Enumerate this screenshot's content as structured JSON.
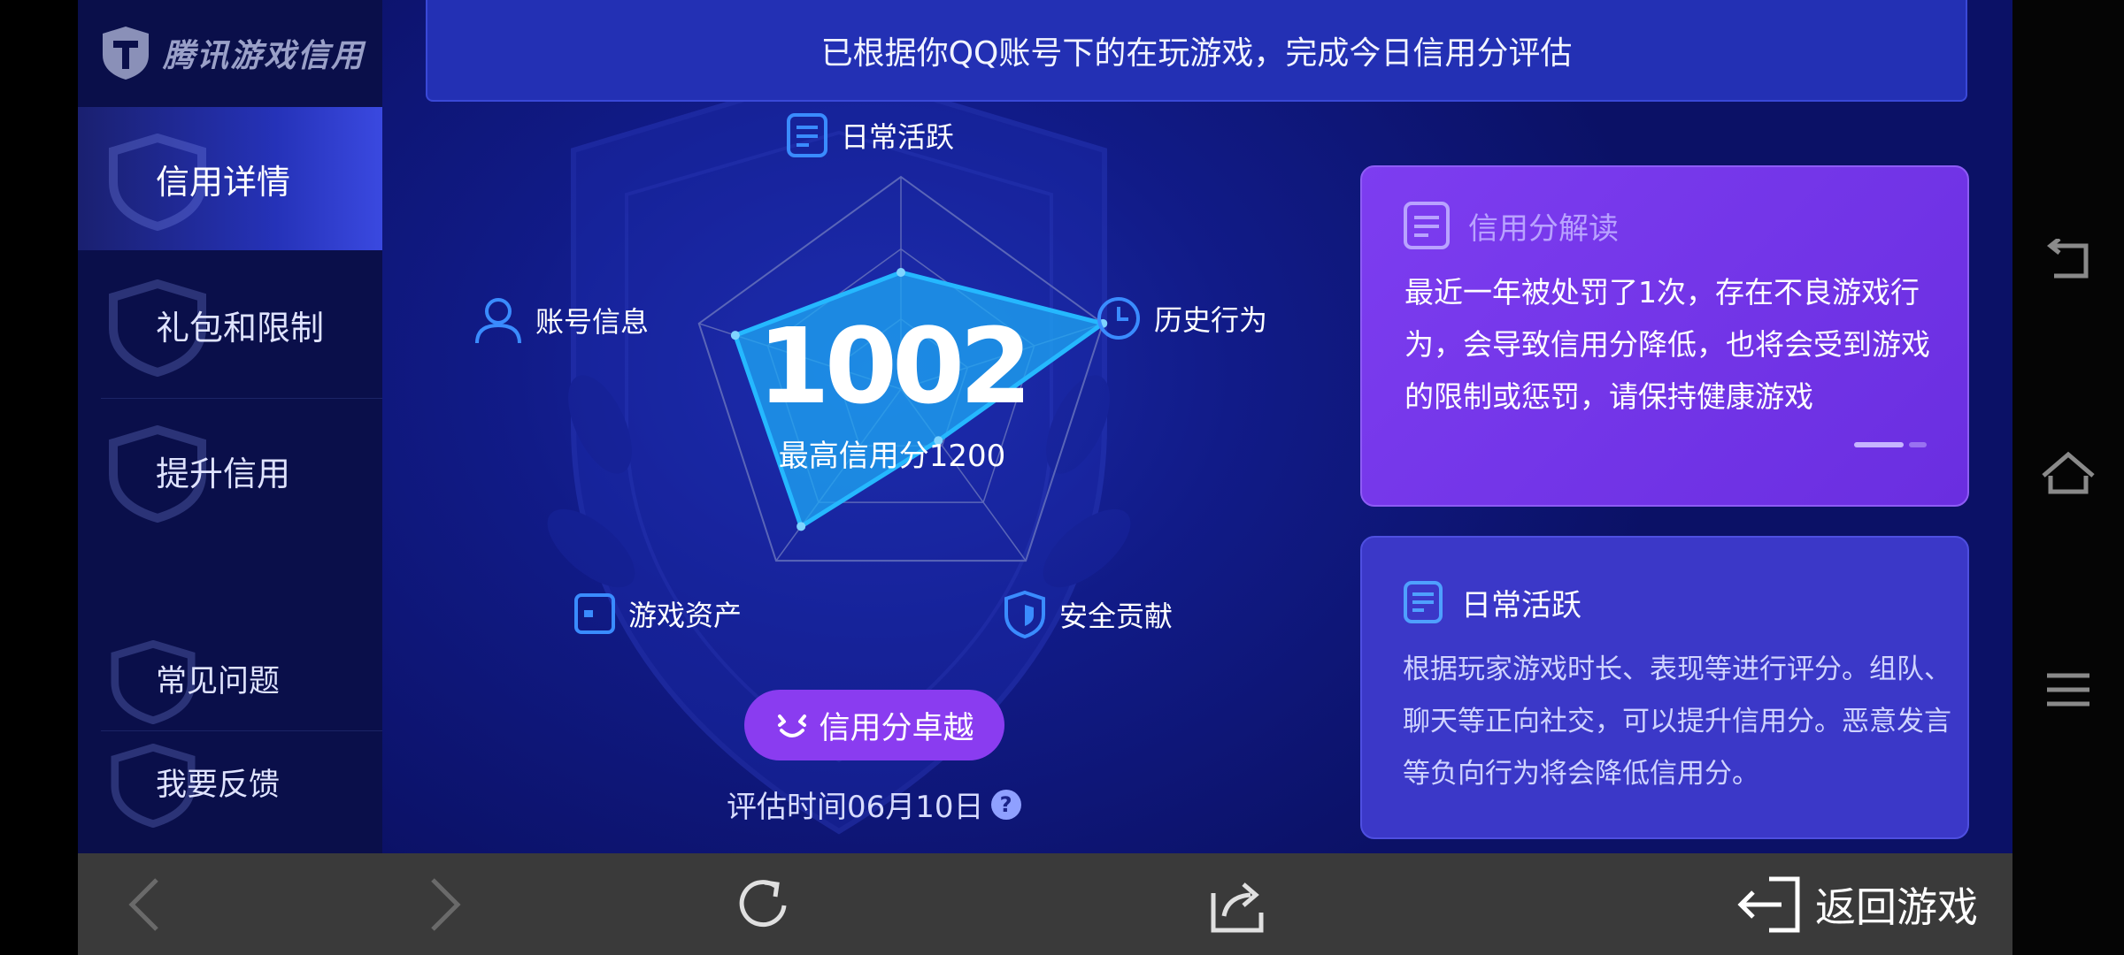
{
  "brand": {
    "name": "腾讯游戏信用"
  },
  "sidebar": {
    "items": [
      {
        "label": "信用详情",
        "active": true
      },
      {
        "label": "礼包和限制",
        "active": false
      },
      {
        "label": "提升信用",
        "active": false
      }
    ],
    "bottom_items": [
      {
        "label": "常见问题"
      },
      {
        "label": "我要反馈"
      }
    ]
  },
  "banner": {
    "text": "已根据你QQ账号下的在玩游戏，完成今日信用分评估"
  },
  "radar": {
    "axes": [
      {
        "label": "日常活跃",
        "icon": "document-icon",
        "value": 0.55
      },
      {
        "label": "历史行为",
        "icon": "clock-icon",
        "value": 1.0
      },
      {
        "label": "安全贡献",
        "icon": "shield-icon",
        "value": 0.3
      },
      {
        "label": "游戏资产",
        "icon": "wallet-icon",
        "value": 0.8
      },
      {
        "label": "账号信息",
        "icon": "user-icon",
        "value": 0.82
      }
    ],
    "fill_color": "#1eaaf5",
    "stroke_color": "#25b8ff"
  },
  "score": {
    "value": "1002",
    "max_label": "最高信用分1200"
  },
  "level_button": {
    "label": "信用分卓越"
  },
  "eval": {
    "text": "评估时间06月10日",
    "help": "?"
  },
  "card_interpret": {
    "title": "信用分解读",
    "body": "最近一年被处罚了1次，存在不良游戏行为，会导致信用分降低，也将会受到游戏的限制或惩罚，请保持健康游戏"
  },
  "card_daily": {
    "title": "日常活跃",
    "body": "根据玩家游戏时长、表现等进行评分。组队、聊天等正向社交，可以提升信用分。恶意发言等负向行为将会降低信用分。"
  },
  "bottombar": {
    "return_label": "返回游戏"
  },
  "colors": {
    "accent": "#8a3cf0",
    "banner": "#2330b4",
    "card_purple": "#7d3df0"
  }
}
